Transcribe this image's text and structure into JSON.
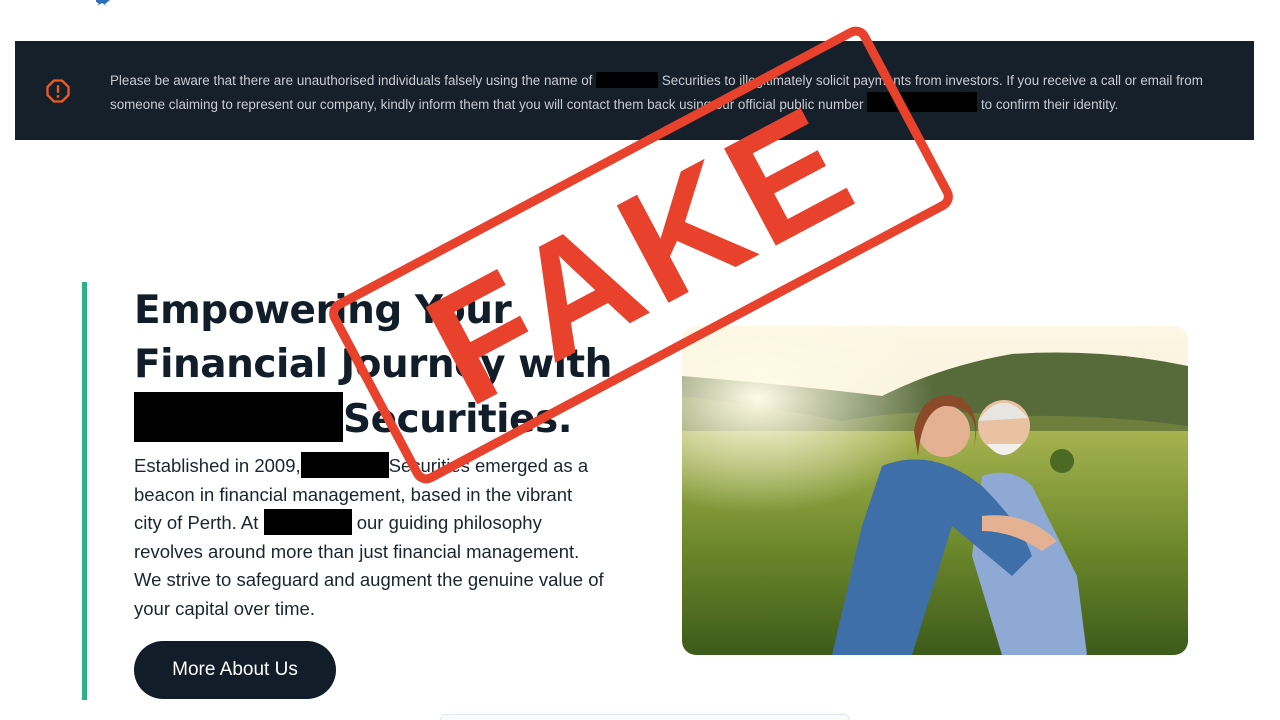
{
  "warning_banner": {
    "line1_part1": "Please be aware that there are unauthorised individuals falsely using the name of",
    "line1_part2": "Securities to illegitimately solicit payments from investors. If you receive a call or email from",
    "line2_part1": "someone claiming to represent our company, kindly inform them that you will contact them back using our official public number",
    "line2_part2": "to confirm their identity."
  },
  "hero": {
    "title_line1": "Empowering Your",
    "title_line2": "Financial Journey with",
    "title_line3": "Securities.",
    "body_part1": "Established in 2009,",
    "body_part2": "Securities emerged as a beacon in financial management, based in the vibrant city of Perth. At",
    "body_part3": "our guiding philosophy revolves around more than just financial management. We strive to safeguard and augment the genuine value of your capital over time.",
    "button_label": "More About Us"
  },
  "stamp": {
    "text": "FAKE",
    "color": "#e8412c"
  },
  "colors": {
    "banner_bg": "#15202b",
    "accent": "#2fb08a",
    "warning_icon": "#ef5a22",
    "button_bg": "#111d29"
  },
  "icons": {
    "warning": "alert-circle-icon",
    "logo": "star-logo-icon"
  }
}
